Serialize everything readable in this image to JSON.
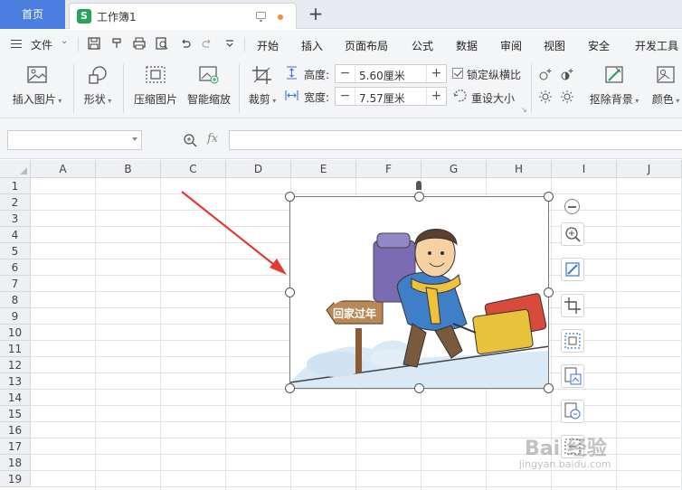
{
  "tabs": {
    "home": "首页",
    "workbook": "工作簿1"
  },
  "menu": {
    "file": "文件",
    "items": [
      "开始",
      "插入",
      "页面布局",
      "公式",
      "数据",
      "审阅",
      "视图",
      "安全",
      "开发工具"
    ]
  },
  "ribbon": {
    "insert_picture": "插入图片",
    "shape": "形状",
    "compress_picture": "压缩图片",
    "smart_zoom": "智能缩放",
    "crop": "裁剪",
    "height_label": "高度:",
    "height_value": "5.60厘米",
    "width_label": "宽度:",
    "width_value": "7.57厘米",
    "lock_ratio": "锁定纵横比",
    "reset_size": "重设大小",
    "remove_background": "抠除背景",
    "color": "颜色"
  },
  "formula": {
    "fx": "fx",
    "namebox_value": "",
    "content": ""
  },
  "grid": {
    "columns": [
      "A",
      "B",
      "C",
      "D",
      "E",
      "F",
      "G",
      "H",
      "I",
      "J"
    ],
    "rows": [
      "1",
      "2",
      "3",
      "4",
      "5",
      "6",
      "7",
      "8",
      "9",
      "10",
      "11",
      "12",
      "13",
      "14",
      "15",
      "16",
      "17",
      "18",
      "19"
    ]
  },
  "picture": {
    "sign_text": "回家过年"
  },
  "watermark": {
    "main": "Bai 经验",
    "sub": "jingyan.baidu.com"
  },
  "colors": {
    "accent": "#4a7fe0",
    "logo_green": "#27a35b",
    "arrow_red": "#e53935"
  }
}
